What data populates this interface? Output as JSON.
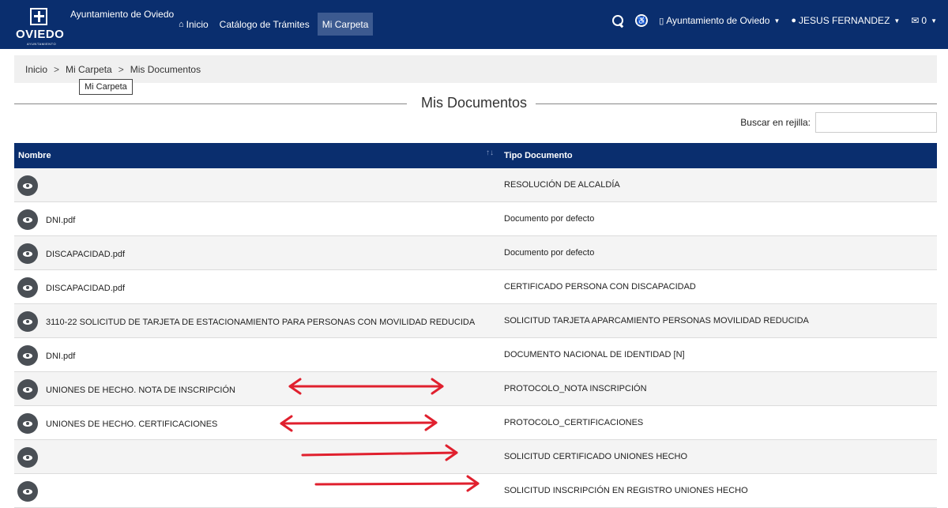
{
  "header": {
    "logo_text": "OVIEDO",
    "logo_sub": "AYUNTAMIENTO",
    "city_name": "Ayuntamiento de Oviedo",
    "nav": [
      {
        "label": "Inicio",
        "icon": "home-icon"
      },
      {
        "label": "Catálogo de Trámites"
      },
      {
        "label": "Mi Carpeta",
        "active": true
      }
    ],
    "org_menu": "Ayuntamiento de Oviedo",
    "user_menu": "JESUS FERNANDEZ",
    "messages_count": "0"
  },
  "breadcrumb": {
    "items": [
      "Inicio",
      "Mi Carpeta",
      "Mis Documentos"
    ],
    "separator": ">",
    "tooltip": "Mi Carpeta"
  },
  "page": {
    "title": "Mis Documentos",
    "search_label": "Buscar en rejilla:",
    "search_value": ""
  },
  "table": {
    "headers": {
      "name": "Nombre",
      "type": "Tipo Documento",
      "sort_icon": "↑↓"
    },
    "rows": [
      {
        "name": "",
        "type": "RESOLUCIÓN DE ALCALDÍA"
      },
      {
        "name": "DNI.pdf",
        "type": "Documento por defecto"
      },
      {
        "name": "DISCAPACIDAD.pdf",
        "type": "Documento por defecto"
      },
      {
        "name": "DISCAPACIDAD.pdf",
        "type": "CERTIFICADO PERSONA CON DISCAPACIDAD"
      },
      {
        "name": "3110-22 SOLICITUD DE TARJETA DE ESTACIONAMIENTO PARA PERSONAS CON MOVILIDAD REDUCIDA",
        "type": "SOLICITUD TARJETA APARCAMIENTO PERSONAS MOVILIDAD REDUCIDA"
      },
      {
        "name": "DNI.pdf",
        "type": "DOCUMENTO NACIONAL DE IDENTIDAD [N]"
      },
      {
        "name": "UNIONES DE HECHO. NOTA DE INSCRIPCIÓN",
        "type": "PROTOCOLO_NOTA INSCRIPCIÓN"
      },
      {
        "name": "UNIONES DE HECHO. CERTIFICACIONES",
        "type": "PROTOCOLO_CERTIFICACIONES"
      },
      {
        "name": "",
        "type": "SOLICITUD CERTIFICADO UNIONES HECHO"
      },
      {
        "name": "",
        "type": "SOLICITUD INSCRIPCIÓN EN REGISTRO UNIONES HECHO"
      }
    ]
  },
  "colors": {
    "navbar": "#0a2e6e",
    "nav_active": "#3c5a90",
    "annotation_arrow": "#e0202e",
    "eye_button": "#4a4f55"
  }
}
